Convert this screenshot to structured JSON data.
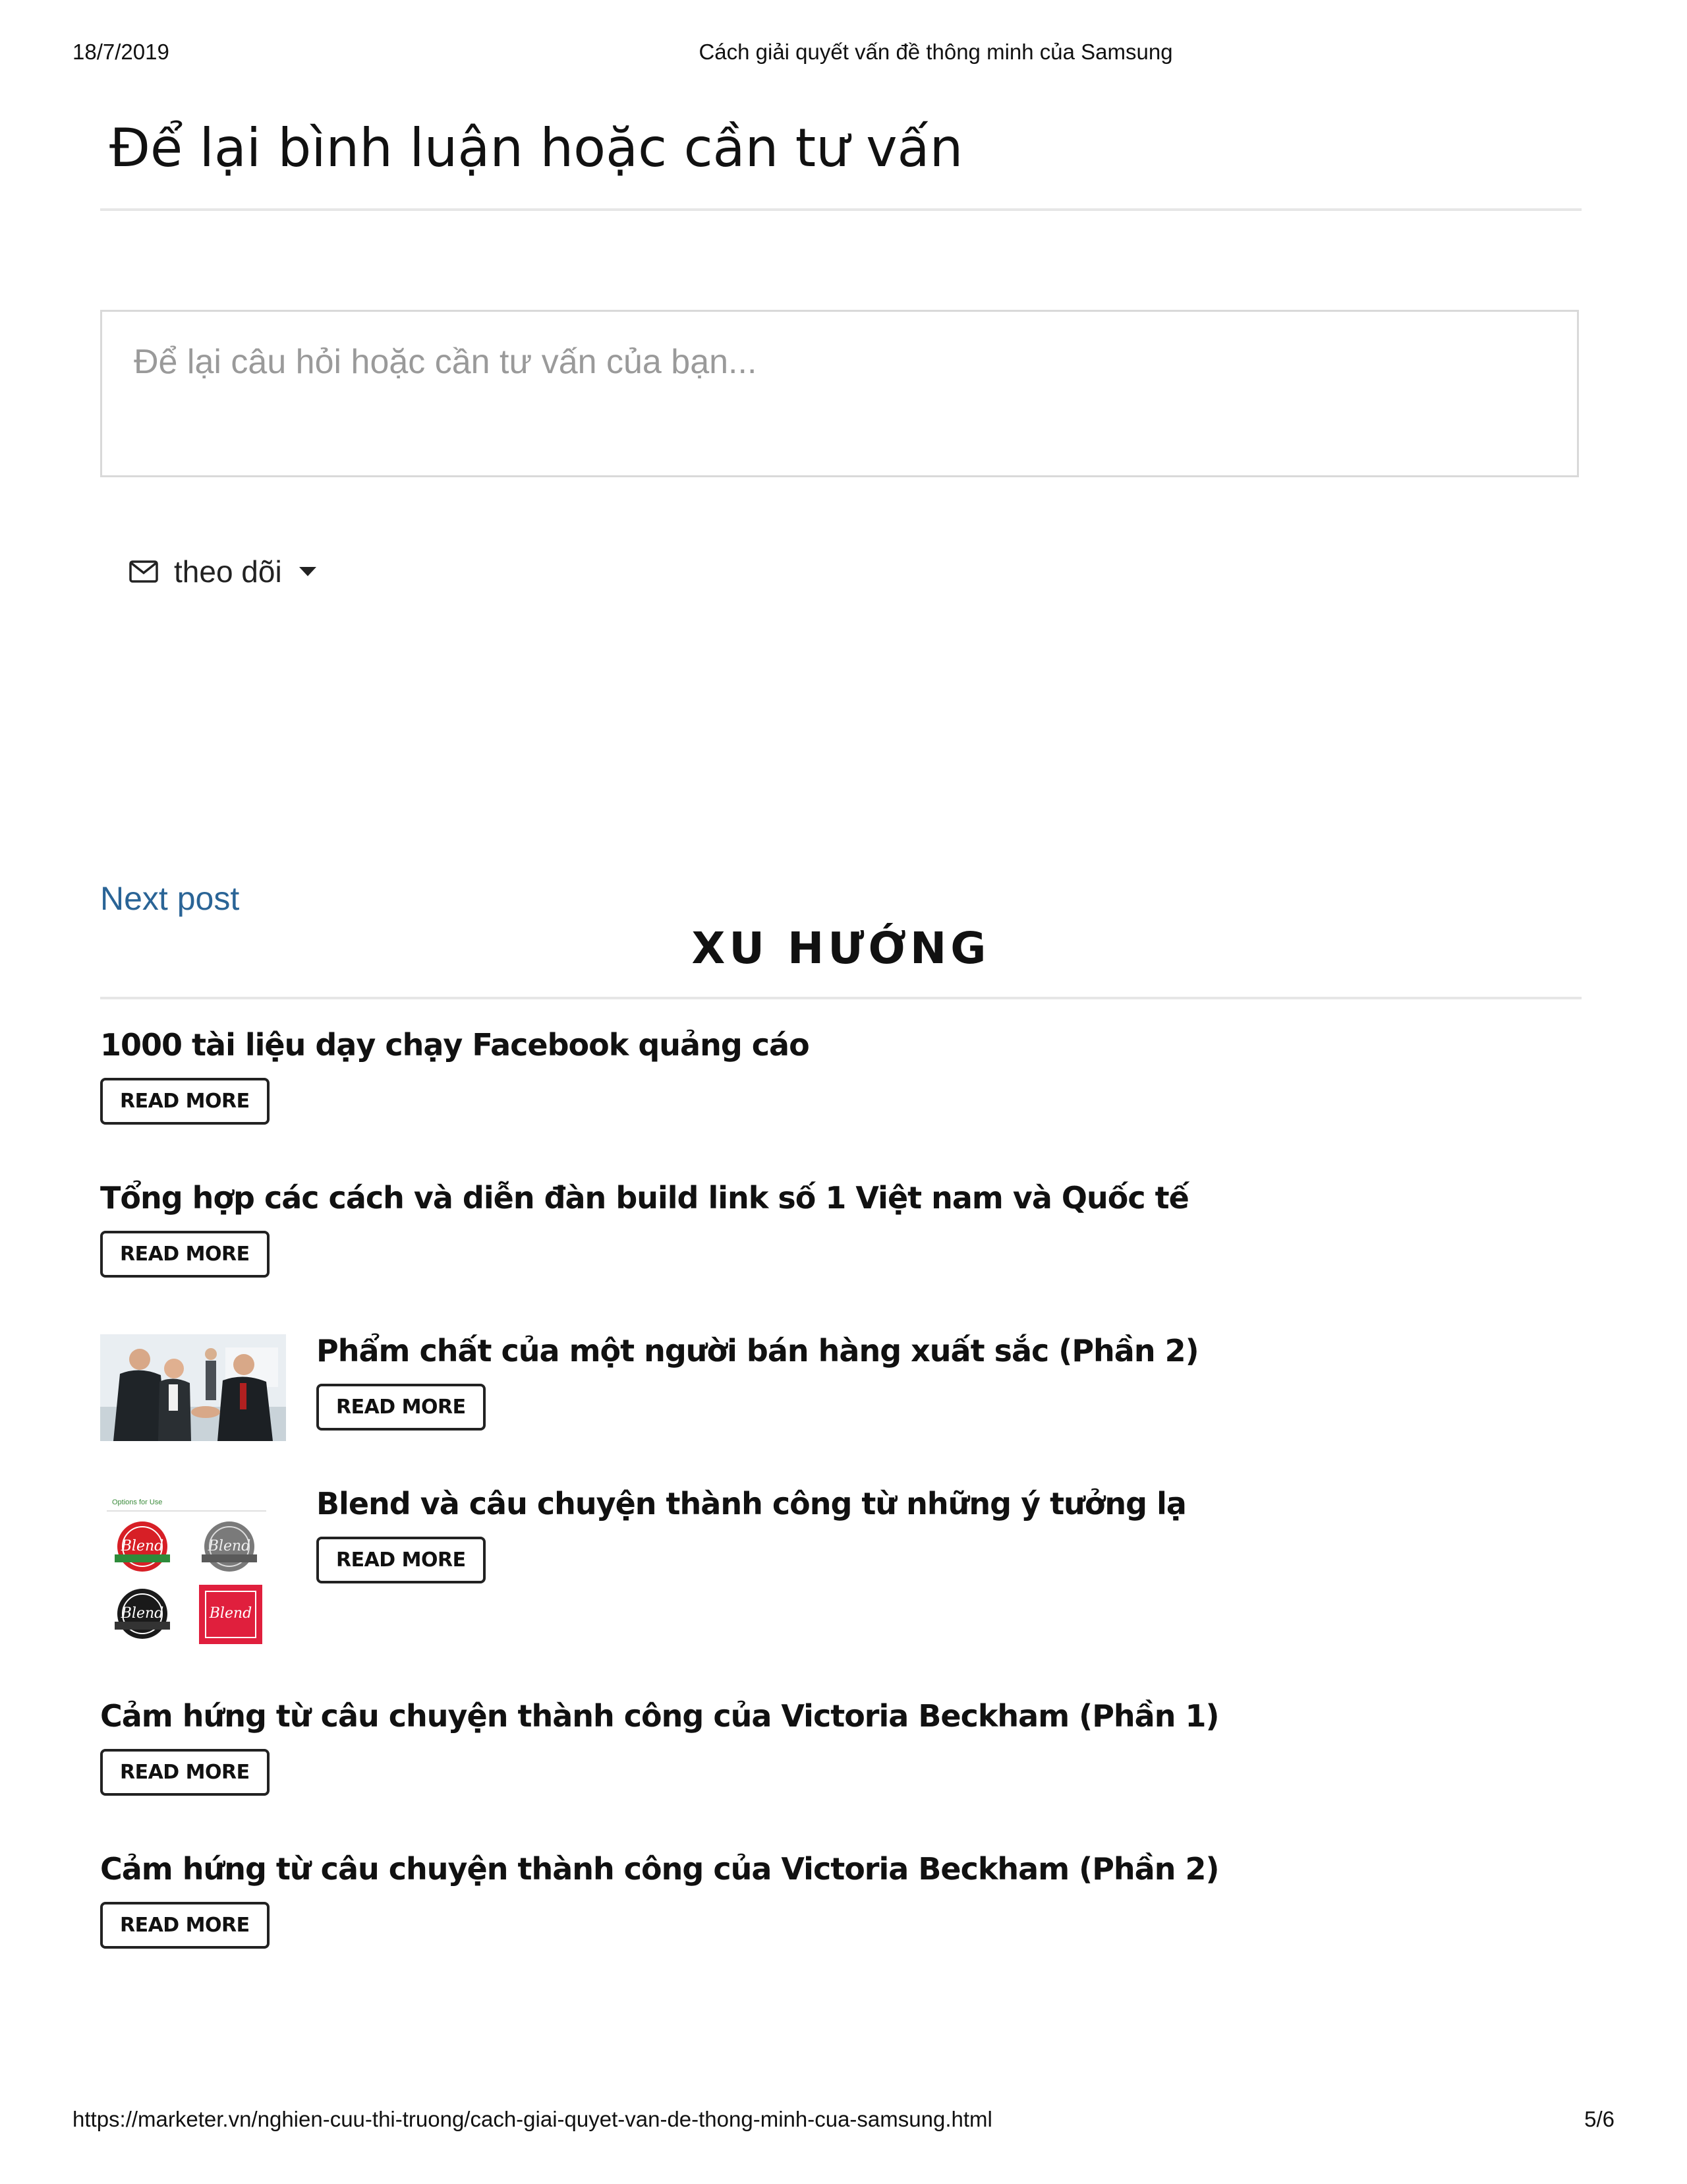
{
  "pdf_header": {
    "date": "18/7/2019",
    "title": "Cách giải quyết vấn đề thông minh của Samsung"
  },
  "comments": {
    "heading": "Để lại bình luận hoặc cần tư vấn",
    "placeholder": "Để lại câu hỏi hoặc cần tư vấn của bạn...",
    "follow_label": "theo dõi",
    "follow_icon": "envelope-icon"
  },
  "next_post_label": "Next post",
  "trending": {
    "heading": "XU HƯỚNG",
    "items": [
      {
        "title": "1000 tài liệu dạy chạy Facebook quảng cáo",
        "button": "READ MORE"
      },
      {
        "title": "Tổng hợp các cách và diễn đàn build link số 1 Việt nam và Quốc tế",
        "button": "READ MORE"
      },
      {
        "title": "Phẩm chất của một người bán hàng xuất sắc (Phần 2)",
        "button": "READ MORE"
      },
      {
        "title": "Blend và câu chuyện thành công từ những ý tưởng lạ",
        "button": "READ MORE",
        "thumb_caption": "Options for Use",
        "logo_text": "Blend"
      },
      {
        "title": "Cảm hứng từ câu chuyện thành công của Victoria Beckham (Phần 1)",
        "button": "READ MORE"
      },
      {
        "title": "Cảm hứng từ câu chuyện thành công của Victoria Beckham (Phần 2)",
        "button": "READ MORE"
      }
    ]
  },
  "pdf_footer": {
    "url": "https://marketer.vn/nghien-cuu-thi-truong/cach-giai-quyet-van-de-thong-minh-cua-samsung.html",
    "page": "5/6"
  },
  "colors": {
    "link": "#2a6496",
    "placeholder": "#9a9a9a",
    "divider": "#e6e6e6"
  }
}
